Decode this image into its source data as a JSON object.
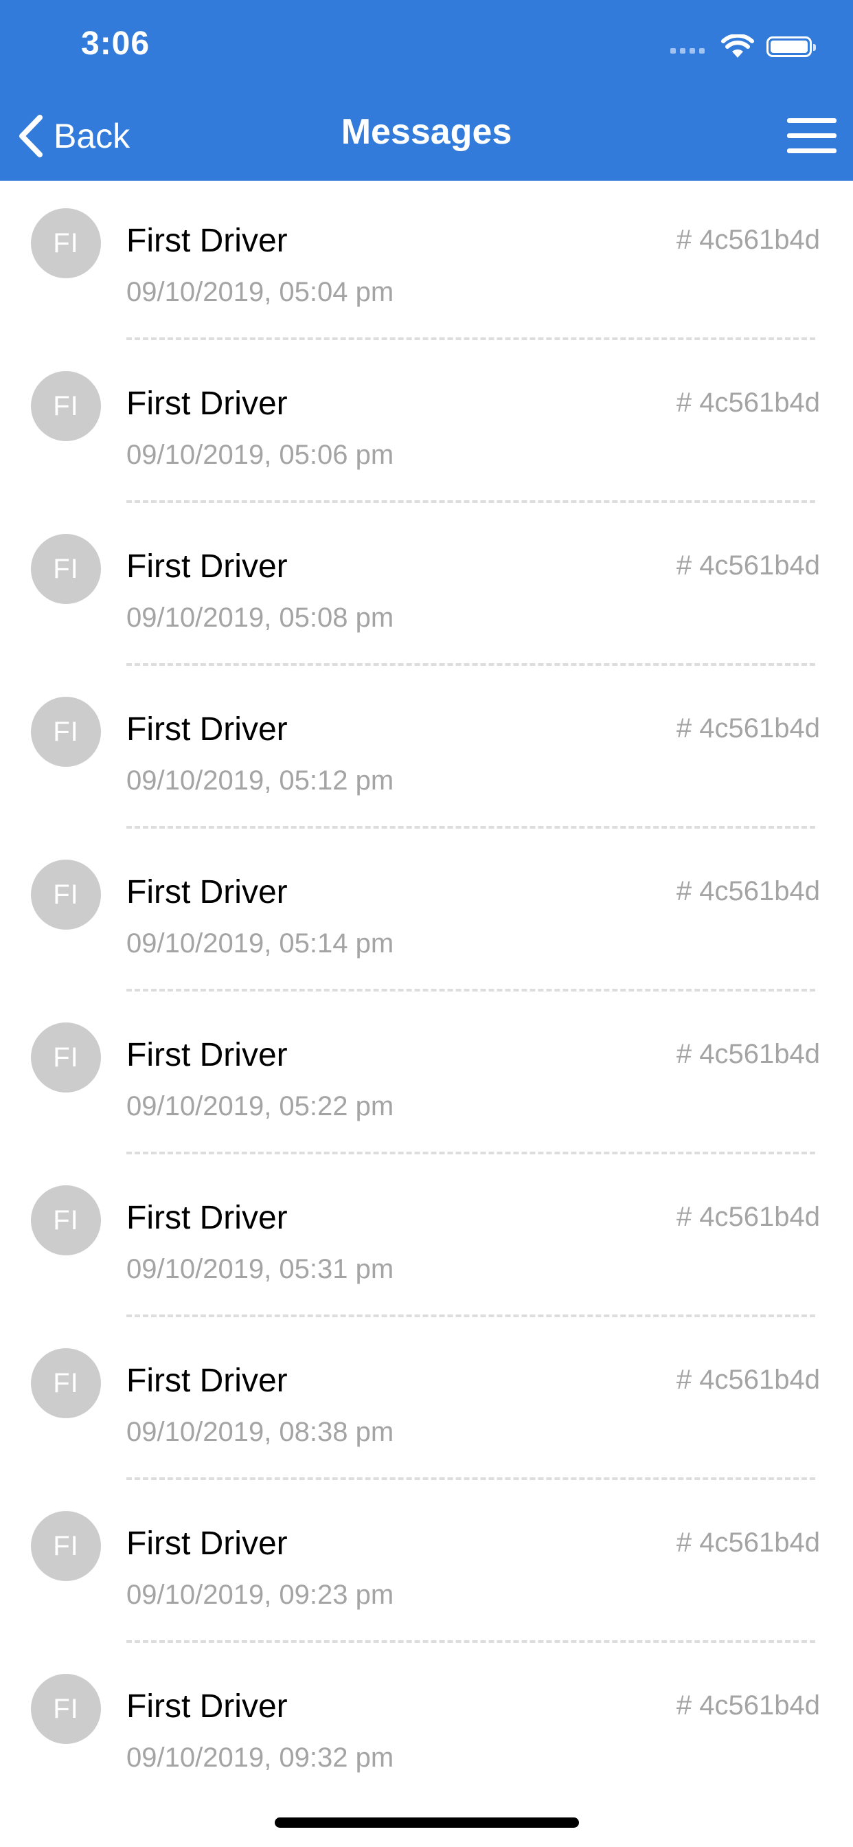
{
  "status_bar": {
    "time": "3:06"
  },
  "nav": {
    "back_label": "Back",
    "title": "Messages"
  },
  "messages": [
    {
      "initials": "FI",
      "name": "First Driver",
      "timestamp": "09/10/2019, 05:04 pm",
      "code": "# 4c561b4d"
    },
    {
      "initials": "FI",
      "name": "First Driver",
      "timestamp": "09/10/2019, 05:06 pm",
      "code": "# 4c561b4d"
    },
    {
      "initials": "FI",
      "name": "First Driver",
      "timestamp": "09/10/2019, 05:08 pm",
      "code": "# 4c561b4d"
    },
    {
      "initials": "FI",
      "name": "First Driver",
      "timestamp": "09/10/2019, 05:12 pm",
      "code": "# 4c561b4d"
    },
    {
      "initials": "FI",
      "name": "First Driver",
      "timestamp": "09/10/2019, 05:14 pm",
      "code": "# 4c561b4d"
    },
    {
      "initials": "FI",
      "name": "First Driver",
      "timestamp": "09/10/2019, 05:22 pm",
      "code": "# 4c561b4d"
    },
    {
      "initials": "FI",
      "name": "First Driver",
      "timestamp": "09/10/2019, 05:31 pm",
      "code": "# 4c561b4d"
    },
    {
      "initials": "FI",
      "name": "First Driver",
      "timestamp": "09/10/2019, 08:38 pm",
      "code": "# 4c561b4d"
    },
    {
      "initials": "FI",
      "name": "First Driver",
      "timestamp": "09/10/2019, 09:23 pm",
      "code": "# 4c561b4d"
    },
    {
      "initials": "FI",
      "name": "First Driver",
      "timestamp": "09/10/2019, 09:32 pm",
      "code": "# 4c561b4d"
    }
  ],
  "icons": {
    "back": "chevron-left-icon",
    "menu": "hamburger-menu-icon",
    "wifi": "wifi-icon",
    "battery": "battery-icon",
    "signal": "cellular-signal-icon"
  },
  "colors": {
    "header": "#327bdb",
    "avatar": "#cccccc",
    "secondary_text": "#a4a4a4"
  }
}
